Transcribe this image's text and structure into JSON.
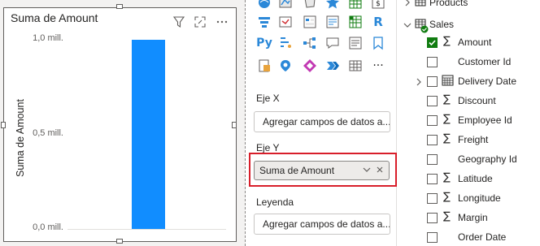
{
  "visual": {
    "title": "Suma de Amount",
    "y_axis_label": "Suma de Amount",
    "icons": [
      "filter-icon",
      "focus-mode-icon",
      "more-options-icon"
    ]
  },
  "chart_data": {
    "type": "bar",
    "categories": [
      ""
    ],
    "values": [
      1.0
    ],
    "title": "Suma de Amount",
    "xlabel": "",
    "ylabel": "Suma de Amount",
    "ylim": [
      0,
      1.0
    ],
    "ytick_labels": [
      "1,0 mill.",
      "0,5 mill.",
      "0,0 mill."
    ],
    "ytick_values": [
      1.0,
      0.5,
      0.0
    ],
    "color": "#118dff",
    "grid": false,
    "legend": "none"
  },
  "viz_pane": {
    "py_label": "Py",
    "r_label": "R",
    "more_label": "···",
    "x_axis": {
      "label": "Eje X",
      "placeholder": "Agregar campos de datos a..."
    },
    "y_axis": {
      "label": "Eje Y",
      "field": "Suma de Amount"
    },
    "legend": {
      "label": "Leyenda",
      "placeholder": "Agregar campos de datos a..."
    },
    "highlight_color": "#d81e2a"
  },
  "fields": {
    "tables": [
      {
        "name": "Products",
        "expanded": false
      },
      {
        "name": "Sales",
        "expanded": true
      }
    ],
    "sales_fields": [
      {
        "name": "Amount",
        "sigma": true,
        "checked": true
      },
      {
        "name": "Customer Id",
        "sigma": false,
        "checked": false
      },
      {
        "name": "Delivery Date",
        "sigma": false,
        "checked": false,
        "date": true
      },
      {
        "name": "Discount",
        "sigma": true,
        "checked": false
      },
      {
        "name": "Employee Id",
        "sigma": true,
        "checked": false
      },
      {
        "name": "Freight",
        "sigma": true,
        "checked": false
      },
      {
        "name": "Geography Id",
        "sigma": false,
        "checked": false
      },
      {
        "name": "Latitude",
        "sigma": true,
        "checked": false
      },
      {
        "name": "Longitude",
        "sigma": true,
        "checked": false
      },
      {
        "name": "Margin",
        "sigma": true,
        "checked": false
      },
      {
        "name": "Order Date",
        "sigma": false,
        "checked": false
      }
    ]
  }
}
